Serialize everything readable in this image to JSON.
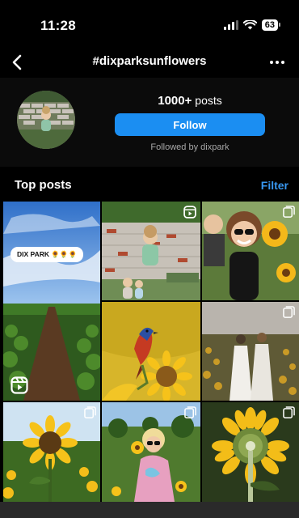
{
  "status_bar": {
    "time": "11:28",
    "battery": "63",
    "icons": [
      "signal-icon",
      "wifi-icon",
      "battery-icon"
    ]
  },
  "nav": {
    "title": "#dixparksunflowers",
    "back_icon": "chevron-left-icon",
    "more_icon": "ellipsis-icon"
  },
  "profile": {
    "post_count": "1000+",
    "post_label": "posts",
    "follow_label": "Follow",
    "followed_by": "Followed by dixpark"
  },
  "section": {
    "title": "Top posts",
    "filter_label": "Filter"
  },
  "posts": [
    {
      "overlay_text": "DIX PARK 🌻🌻🌻",
      "type": "reel"
    },
    {
      "type": "reel"
    },
    {
      "type": "carousel"
    },
    {
      "type": "photo"
    },
    {
      "type": "carousel"
    },
    {
      "type": "carousel"
    },
    {
      "type": "carousel"
    },
    {
      "type": "carousel"
    }
  ],
  "colors": {
    "background": "#000000",
    "accent": "#1b8ef2",
    "link": "#3897f0",
    "muted_text": "#a8a8a8"
  }
}
